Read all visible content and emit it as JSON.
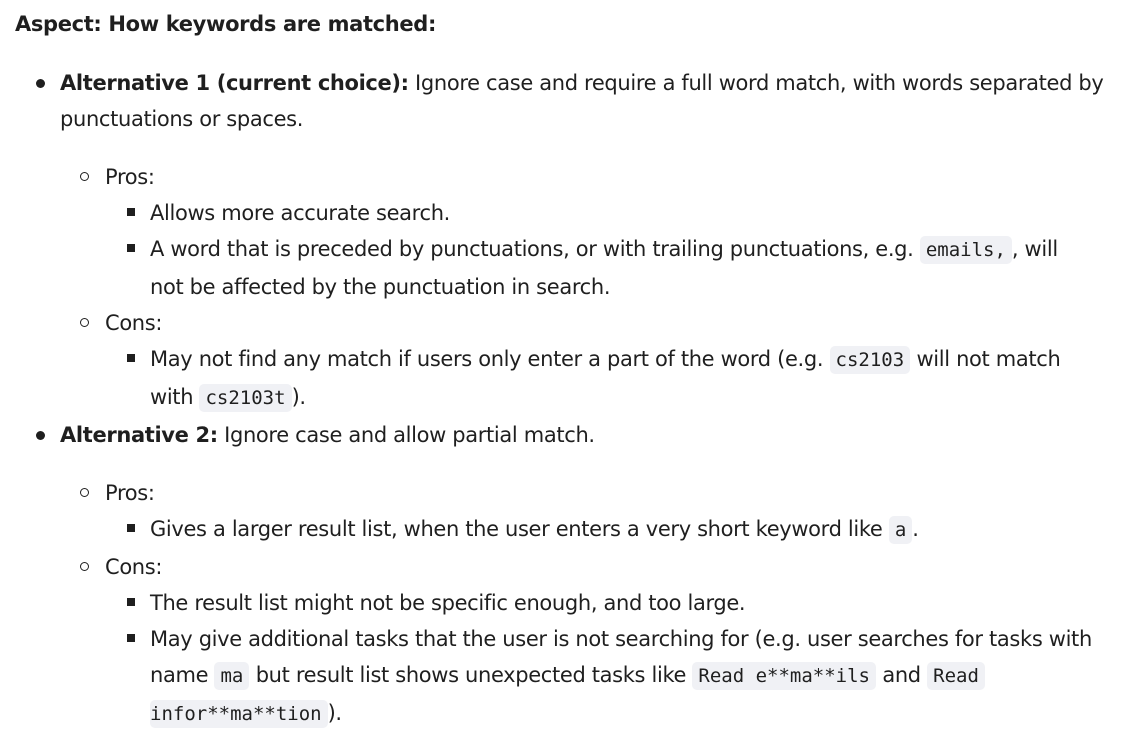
{
  "heading": "Aspect: How keywords are matched:",
  "alt1": {
    "label": "Alternative 1 (current choice):",
    "text_a": " Ignore case and require a full word match, with words separated by",
    "text_b": "punctuations or spaces.",
    "pros_label": "Pros:",
    "pro1": "Allows more accurate search.",
    "pro2_a": "A word that is preceded by punctuations, or with trailing punctuations, e.g.",
    "pro2_code": "emails,",
    "pro2_b": ", will",
    "pro2_c": "not be affected by the punctuation in search.",
    "cons_label": "Cons:",
    "con1_a": "May not find any match if users only enter a part of the word (e.g.",
    "con1_code1": "cs2103",
    "con1_b": "will not match",
    "con1_c": "with",
    "con1_code2": "cs2103t",
    "con1_d": ")."
  },
  "alt2": {
    "label": "Alternative 2:",
    "text": " Ignore case and allow partial match.",
    "pros_label": "Pros:",
    "pro1_a": "Gives a larger result list, when the user enters a very short keyword like",
    "pro1_code": "a",
    "pro1_b": ".",
    "cons_label": "Cons:",
    "con1": "The result list might not be specific enough, and too large.",
    "con2_a": "May give additional tasks that the user is not searching for (e.g. user searches for tasks with",
    "con2_b": "name",
    "con2_code1": "ma",
    "con2_c": "but result list shows unexpected tasks like",
    "con2_code2": "Read e**ma**ils",
    "con2_d": "and",
    "con2_code3": "Read",
    "con2_code4": "infor**ma**tion",
    "con2_e": ")."
  }
}
